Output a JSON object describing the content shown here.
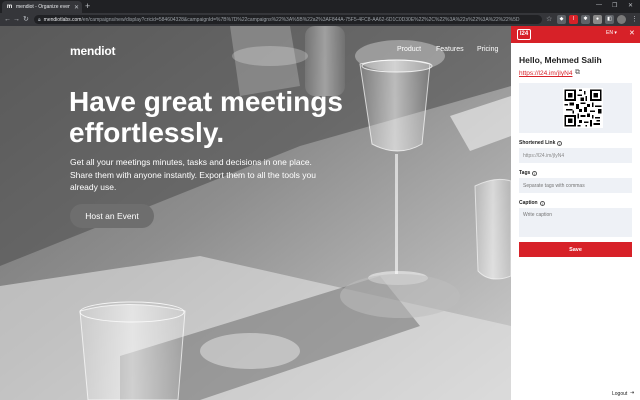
{
  "browser": {
    "tab_favicon": "m",
    "tab_title": "mendiot - Organize events and meetings",
    "url_host": "mendiotlabs.com",
    "url_path": "/en/campaigns/new/display?cricid=584604328&campaignId=%7B%7D%22campaigns%22%3A%5B%22a2%3AF844A-75F5-4FC8-AA62-6D1C0D30E%22%2C%22%3A%22s%22%3A%22%22%5D",
    "icons": {
      "back": "back-arrow-icon",
      "forward": "forward-arrow-icon",
      "reload": "reload-icon",
      "lock": "lock-icon",
      "star": "star-icon",
      "menu": "kebab-menu-icon"
    }
  },
  "site": {
    "logo": "mendiot",
    "nav": [
      "Product",
      "Features",
      "Pricing"
    ],
    "hero_title": "Have great meetings effortlessly.",
    "hero_subtitle": "Get all your meetings minutes, tasks and decisions in one place. Share them with anyone instantly. Export them to all the tools you already use.",
    "cta_label": "Host an Event"
  },
  "panel": {
    "logo": "l24",
    "language": "EN",
    "greeting": "Hello, Mehmed Salih",
    "short_link": "https://l24.im/jIyN4",
    "shortened_link_label": "Shortened Link",
    "shortened_link_value": "https://l24.im/jIyN4",
    "tags_label": "Tags",
    "tags_placeholder": "Separate tags with commas",
    "caption_label": "Caption",
    "caption_placeholder": "Write caption",
    "save_label": "Save",
    "logout_label": "Logout",
    "colors": {
      "brand": "#d72128",
      "field_bg": "#eef1f6"
    }
  }
}
